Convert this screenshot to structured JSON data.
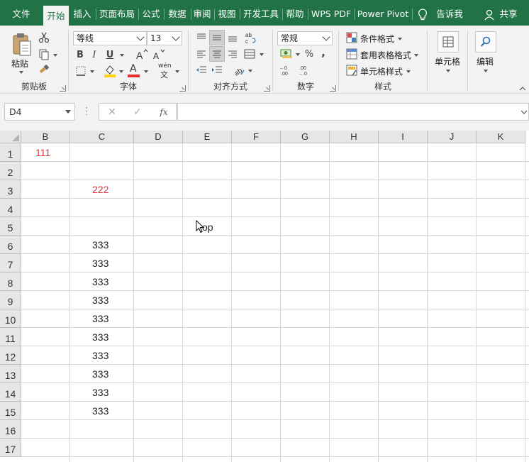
{
  "tabs": [
    {
      "label": "文件",
      "active": false
    },
    {
      "label": "开始",
      "active": true
    },
    {
      "label": "插入",
      "active": false
    },
    {
      "label": "页面布局",
      "active": false
    },
    {
      "label": "公式",
      "active": false
    },
    {
      "label": "数据",
      "active": false
    },
    {
      "label": "审阅",
      "active": false
    },
    {
      "label": "视图",
      "active": false
    },
    {
      "label": "开发工具",
      "active": false
    },
    {
      "label": "帮助",
      "active": false
    },
    {
      "label": "WPS PDF",
      "active": false
    },
    {
      "label": "Power Pivot",
      "active": false
    }
  ],
  "tellme": {
    "label": "告诉我",
    "icon": "lightbulb-icon"
  },
  "share": {
    "label": "共享",
    "icon": "person-icon"
  },
  "ribbon": {
    "clipboard": {
      "label": "剪贴板",
      "paste": "粘贴"
    },
    "font": {
      "label": "字体",
      "font_name": "等线",
      "font_size": "13",
      "bold": "B",
      "italic": "I",
      "underline": "U",
      "font_color_letter": "A",
      "wen_label": "wén"
    },
    "alignment": {
      "label": "对齐方式"
    },
    "number": {
      "label": "数字",
      "format": "常规",
      "percent": "%",
      "comma": ","
    },
    "styles": {
      "label": "样式",
      "conditional": "条件格式",
      "table_format": "套用表格格式",
      "cell_styles": "单元格样式"
    },
    "cells": {
      "label": "单元格"
    },
    "editing": {
      "label": "编辑"
    },
    "colors": {
      "brand": "#217346",
      "highlight": "#ffd400",
      "font_red": "#e03030"
    }
  },
  "formula_bar": {
    "name_box": "D4",
    "fx": "fx",
    "formula": ""
  },
  "grid": {
    "columns": [
      "B",
      "C",
      "D",
      "E",
      "F",
      "G",
      "H",
      "I",
      "J",
      "K"
    ],
    "rows": [
      "1",
      "2",
      "3",
      "4",
      "5",
      "6",
      "7",
      "8",
      "9",
      "10",
      "11",
      "12",
      "13",
      "14",
      "15",
      "16",
      "17"
    ],
    "cells": [
      {
        "ref": "B1",
        "value": "111",
        "color": "#d9363e"
      },
      {
        "ref": "C3",
        "value": "222",
        "color": "#d9363e"
      },
      {
        "ref": "E5",
        "value": "op",
        "color": "#222222"
      },
      {
        "ref": "C6",
        "value": "333",
        "color": "#222222"
      },
      {
        "ref": "C7",
        "value": "333",
        "color": "#222222"
      },
      {
        "ref": "C8",
        "value": "333",
        "color": "#222222"
      },
      {
        "ref": "C9",
        "value": "333",
        "color": "#222222"
      },
      {
        "ref": "C10",
        "value": "333",
        "color": "#222222"
      },
      {
        "ref": "C11",
        "value": "333",
        "color": "#222222"
      },
      {
        "ref": "C12",
        "value": "333",
        "color": "#222222"
      },
      {
        "ref": "C13",
        "value": "333",
        "color": "#222222"
      },
      {
        "ref": "C14",
        "value": "333",
        "color": "#222222"
      },
      {
        "ref": "C15",
        "value": "333",
        "color": "#222222"
      }
    ]
  }
}
